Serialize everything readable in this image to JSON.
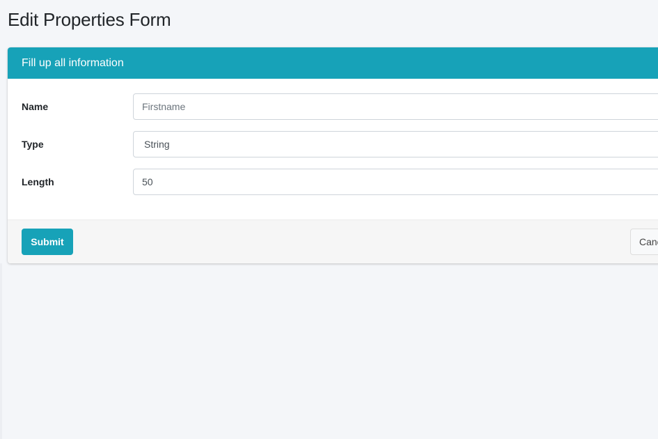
{
  "page": {
    "title": "Edit Properties Form"
  },
  "card": {
    "header": "Fill up all information"
  },
  "form": {
    "name": {
      "label": "Name",
      "value": "",
      "placeholder": "Firstname"
    },
    "type": {
      "label": "Type",
      "selected": "String"
    },
    "length": {
      "label": "Length",
      "value": "50"
    }
  },
  "footer": {
    "submit_label": "Submit",
    "cancel_label": "Cancel"
  },
  "colors": {
    "accent": "#17a2b8",
    "background": "#f4f6f9"
  }
}
